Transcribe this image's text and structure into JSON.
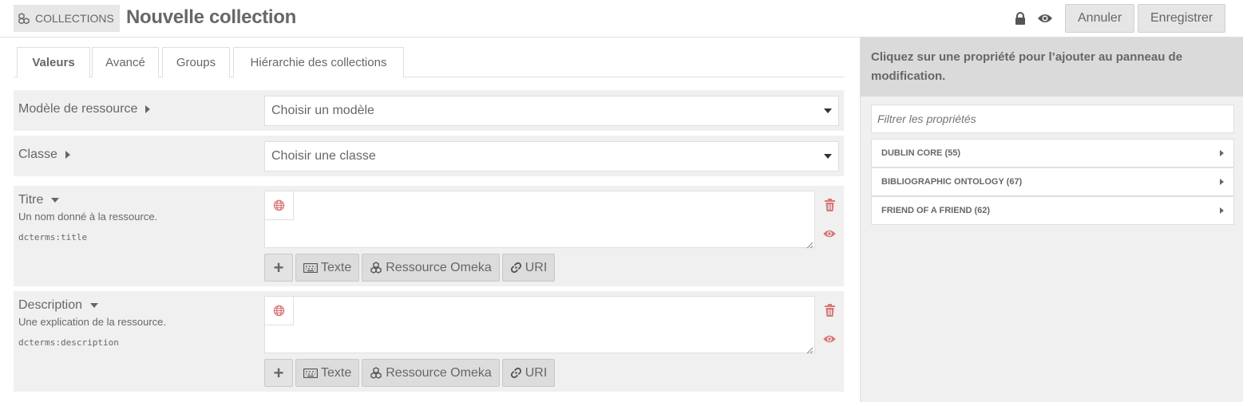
{
  "header": {
    "section_label": "COLLECTIONS",
    "title": "Nouvelle collection",
    "cancel_label": "Annuler",
    "save_label": "Enregistrer",
    "icons": [
      "cubes-icon",
      "lock-icon",
      "eye-icon"
    ]
  },
  "tabs": [
    {
      "label": "Valeurs",
      "active": true
    },
    {
      "label": "Avancé",
      "active": false
    },
    {
      "label": "Groups",
      "active": false
    },
    {
      "label": "Hiérarchie des collections",
      "active": false
    }
  ],
  "form": {
    "resource_template": {
      "label": "Modèle de ressource",
      "selected": "Choisir un modèle"
    },
    "resource_class": {
      "label": "Classe",
      "selected": "Choisir une classe"
    },
    "properties": [
      {
        "label": "Titre",
        "description": "Un nom donné à la ressource.",
        "term": "dcterms:title",
        "value": ""
      },
      {
        "label": "Description",
        "description": "Une explication de la ressource.",
        "term": "dcterms:description",
        "value": ""
      }
    ],
    "value_buttons": {
      "text": "Texte",
      "resource": "Ressource Omeka",
      "uri": "URI"
    }
  },
  "sidebar": {
    "heading": "Cliquez sur une propriété pour l’ajouter au panneau de modification.",
    "filter_placeholder": "Filtrer les propriétés",
    "vocabularies": [
      {
        "label": "DUBLIN CORE (55)"
      },
      {
        "label": "BIBLIOGRAPHIC ONTOLOGY (67)"
      },
      {
        "label": "FRIEND OF A FRIEND (62)"
      }
    ]
  },
  "colors": {
    "accent_red": "#d87777",
    "panel_grey": "#f0f0f0",
    "text": "#676767"
  }
}
